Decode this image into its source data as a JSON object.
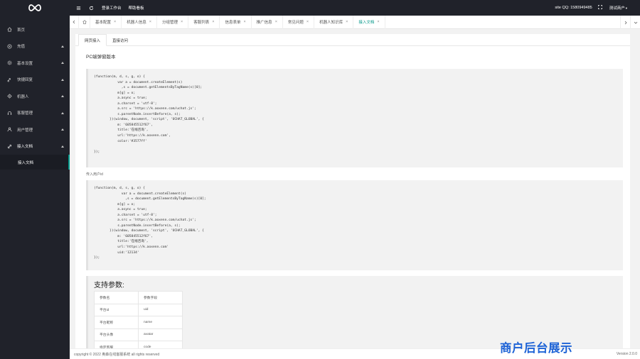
{
  "header": {
    "home_link": "登录工作台",
    "kanban_link": "帮助看板",
    "qq_label": "site QQ:",
    "qq_number": "1580949485",
    "user": "测试商户"
  },
  "sidebar": {
    "items": [
      {
        "label": "首页",
        "icon": "home-icon"
      },
      {
        "label": "充值",
        "icon": "coin-icon"
      },
      {
        "label": "基本设置",
        "icon": "gear-icon"
      },
      {
        "label": "快捷回复",
        "icon": "reply-icon"
      },
      {
        "label": "机器人",
        "icon": "robot-icon"
      },
      {
        "label": "客服管理",
        "icon": "headset-icon"
      },
      {
        "label": "用户管理",
        "icon": "user-icon"
      },
      {
        "label": "接入文档",
        "icon": "link-icon"
      }
    ],
    "subitem": "接入文档"
  },
  "tabs": [
    {
      "label": "基本配置"
    },
    {
      "label": "机器人信息"
    },
    {
      "label": "分组管理"
    },
    {
      "label": "客服列表"
    },
    {
      "label": "信息表单"
    },
    {
      "label": "推广信息"
    },
    {
      "label": "常见问题"
    },
    {
      "label": "机器人知识库"
    },
    {
      "label": "接入文档"
    }
  ],
  "subtabs": {
    "web": "网页接入",
    "direct": "直接访问"
  },
  "content": {
    "title": "PC端弹窗版本",
    "code1": "(function(m, d, s, g, o) {\n            var a = document.createElement(s)\n              ,s = document.getElementsByTagName(s)[0];\n            m[g] = o;\n            a.async = true;\n            a.charset = 'utf-8';\n            a.src = 'https://k.aoxenn.com/uchat.js';\n            s.parentNode.insertBefore(a, s);\n        })(window, document, 'script', 'UCHAT_GLOBAL', {\n            m: '605845512f67',\n            title:'在线咨询',\n            url:'https://k.aoxenn.com',\n            color:'#3577ff'\n\n});",
    "uid_label": "传入用户id",
    "code2": "(function(m, d, s, g, o) {\n              var a = document.createElement(s)\n                ,s = document.getElementsByTagName(s)[0];\n            m[g] = o;\n            a.async = true;\n            a.charset = 'utf-8';\n            a.src = 'https://k.aoxenn.com/uchat.js';\n            s.parentNode.insertBefore(a, s);\n        })(window, document, 'script', 'UCHAT_GLOBAL', {\n            m: '605845512f67',\n            title:'在线咨询',\n            url:'https://k.aoxenn.com'\n            uid:'12134'\n});",
    "params_title": "支持参数:",
    "params_headers": [
      "参数名",
      "参数字段"
    ],
    "params_rows": [
      [
        "平台id",
        "uid"
      ],
      [
        "平台昵称",
        "name"
      ],
      [
        "平台头像",
        "avatar"
      ],
      [
        "指定客服",
        "code"
      ]
    ]
  },
  "footer": {
    "copyright": "copyright © 2022 奥森在线客服系统 all rights reserved",
    "version": "Version 2.0.0"
  },
  "watermark": "商户后台展示",
  "colors": {
    "sidebar_bg": "#20222a",
    "accent": "#009688",
    "watermark": "#1e63d6"
  }
}
